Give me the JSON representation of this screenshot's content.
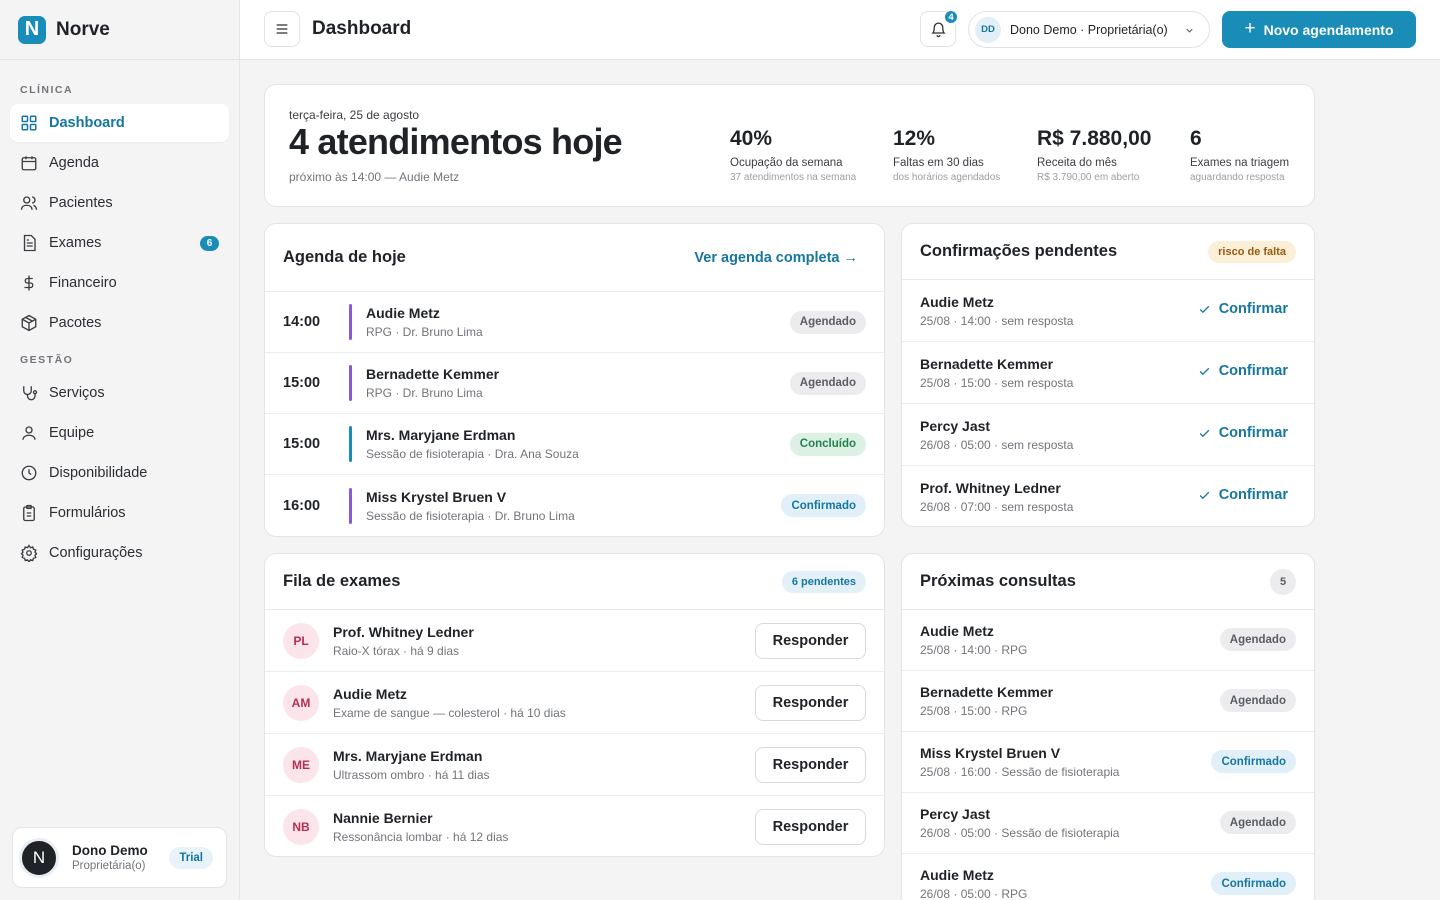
{
  "brand": {
    "initial": "N",
    "name": "Norve"
  },
  "sidebar": {
    "section_clinic": "CLÍNICA",
    "section_management": "GESTÃO",
    "items": [
      {
        "label": "Dashboard",
        "icon": "grid-icon"
      },
      {
        "label": "Agenda",
        "icon": "calendar-icon"
      },
      {
        "label": "Pacientes",
        "icon": "users-icon"
      },
      {
        "label": "Exames",
        "icon": "file-text-icon",
        "badge": "6"
      },
      {
        "label": "Financeiro",
        "icon": "dollar-icon"
      },
      {
        "label": "Pacotes",
        "icon": "package-icon"
      },
      {
        "label": "Serviços",
        "icon": "stethoscope-icon"
      },
      {
        "label": "Equipe",
        "icon": "user-icon"
      },
      {
        "label": "Disponibilidade",
        "icon": "clock-icon"
      },
      {
        "label": "Formulários",
        "icon": "clipboard-icon"
      },
      {
        "label": "Configurações",
        "icon": "gear-icon"
      }
    ],
    "user": {
      "avatar": "N",
      "name": "Dono Demo",
      "role": "Proprietária(o)",
      "badge": "Trial"
    }
  },
  "header": {
    "title": "Dashboard",
    "notifications": "4",
    "profile_initials": "DD",
    "profile_label": "Dono Demo · Proprietária(o)",
    "new_button": "Novo agendamento",
    "new_plus": "+"
  },
  "summary": {
    "date": "terça-feira, 25 de agosto",
    "headline": "4 atendimentos hoje",
    "next": "próximo às 14:00 — Audie Metz",
    "kpis": [
      {
        "value": "40%",
        "label": "Ocupação da semana",
        "sub": "37 atendimentos na semana"
      },
      {
        "value": "12%",
        "label": "Faltas em 30 dias",
        "sub": "dos horários agendados"
      },
      {
        "value": "R$ 7.880,00",
        "label": "Receita do mês",
        "sub": "R$ 3.790,00 em aberto"
      },
      {
        "value": "6",
        "label": "Exames na triagem",
        "sub": "aguardando resposta"
      }
    ]
  },
  "agenda": {
    "title": "Agenda de hoje",
    "link": "Ver agenda completa →",
    "rows": [
      {
        "time": "14:00",
        "name": "Audie Metz",
        "detail": "RPG · Dr. Bruno Lima",
        "status": "Agendado",
        "bar_color": "#8a5ad6"
      },
      {
        "time": "15:00",
        "name": "Bernadette Kemmer",
        "detail": "RPG · Dr. Bruno Lima",
        "status": "Agendado",
        "bar_color": "#8a5ad6"
      },
      {
        "time": "15:00",
        "name": "Mrs. Maryjane Erdman",
        "detail": "Sessão de fisioterapia · Dra. Ana Souza",
        "status": "Concluído",
        "bar_color": "#1a8cb8"
      },
      {
        "time": "16:00",
        "name": "Miss Krystel Bruen V",
        "detail": "Sessão de fisioterapia · Dr. Bruno Lima",
        "status": "Confirmado",
        "bar_color": "#8a5ad6"
      }
    ]
  },
  "confirmations": {
    "title": "Confirmações pendentes",
    "badge": "risco de falta",
    "action": "Confirmar",
    "rows": [
      {
        "name": "Audie Metz",
        "detail": "25/08 · 14:00 · sem resposta"
      },
      {
        "name": "Bernadette Kemmer",
        "detail": "25/08 · 15:00 · sem resposta"
      },
      {
        "name": "Percy Jast",
        "detail": "26/08 · 05:00 · sem resposta"
      },
      {
        "name": "Prof. Whitney Ledner",
        "detail": "26/08 · 07:00 · sem resposta"
      }
    ]
  },
  "exams": {
    "title": "Fila de exames",
    "badge": "6 pendentes",
    "action": "Responder",
    "rows": [
      {
        "initials": "PL",
        "name": "Prof. Whitney Ledner",
        "detail": "Raio-X tórax · há 9 dias"
      },
      {
        "initials": "AM",
        "name": "Audie Metz",
        "detail": "Exame de sangue — colesterol · há 10 dias"
      },
      {
        "initials": "ME",
        "name": "Mrs. Maryjane Erdman",
        "detail": "Ultrassom ombro · há 11 dias"
      },
      {
        "initials": "NB",
        "name": "Nannie Bernier",
        "detail": "Ressonância lombar · há 12 dias"
      }
    ]
  },
  "next_consults": {
    "title": "Próximas consultas",
    "count": "5",
    "rows": [
      {
        "name": "Audie Metz",
        "detail": "25/08 · 14:00 · RPG",
        "status": "Agendado"
      },
      {
        "name": "Bernadette Kemmer",
        "detail": "25/08 · 15:00 · RPG",
        "status": "Agendado"
      },
      {
        "name": "Miss Krystel Bruen V",
        "detail": "25/08 · 16:00 · Sessão de fisioterapia",
        "status": "Confirmado"
      },
      {
        "name": "Percy Jast",
        "detail": "26/08 · 05:00 · Sessão de fisioterapia",
        "status": "Agendado"
      },
      {
        "name": "Audie Metz",
        "detail": "26/08 · 05:00 · RPG",
        "status": "Confirmado"
      }
    ]
  }
}
